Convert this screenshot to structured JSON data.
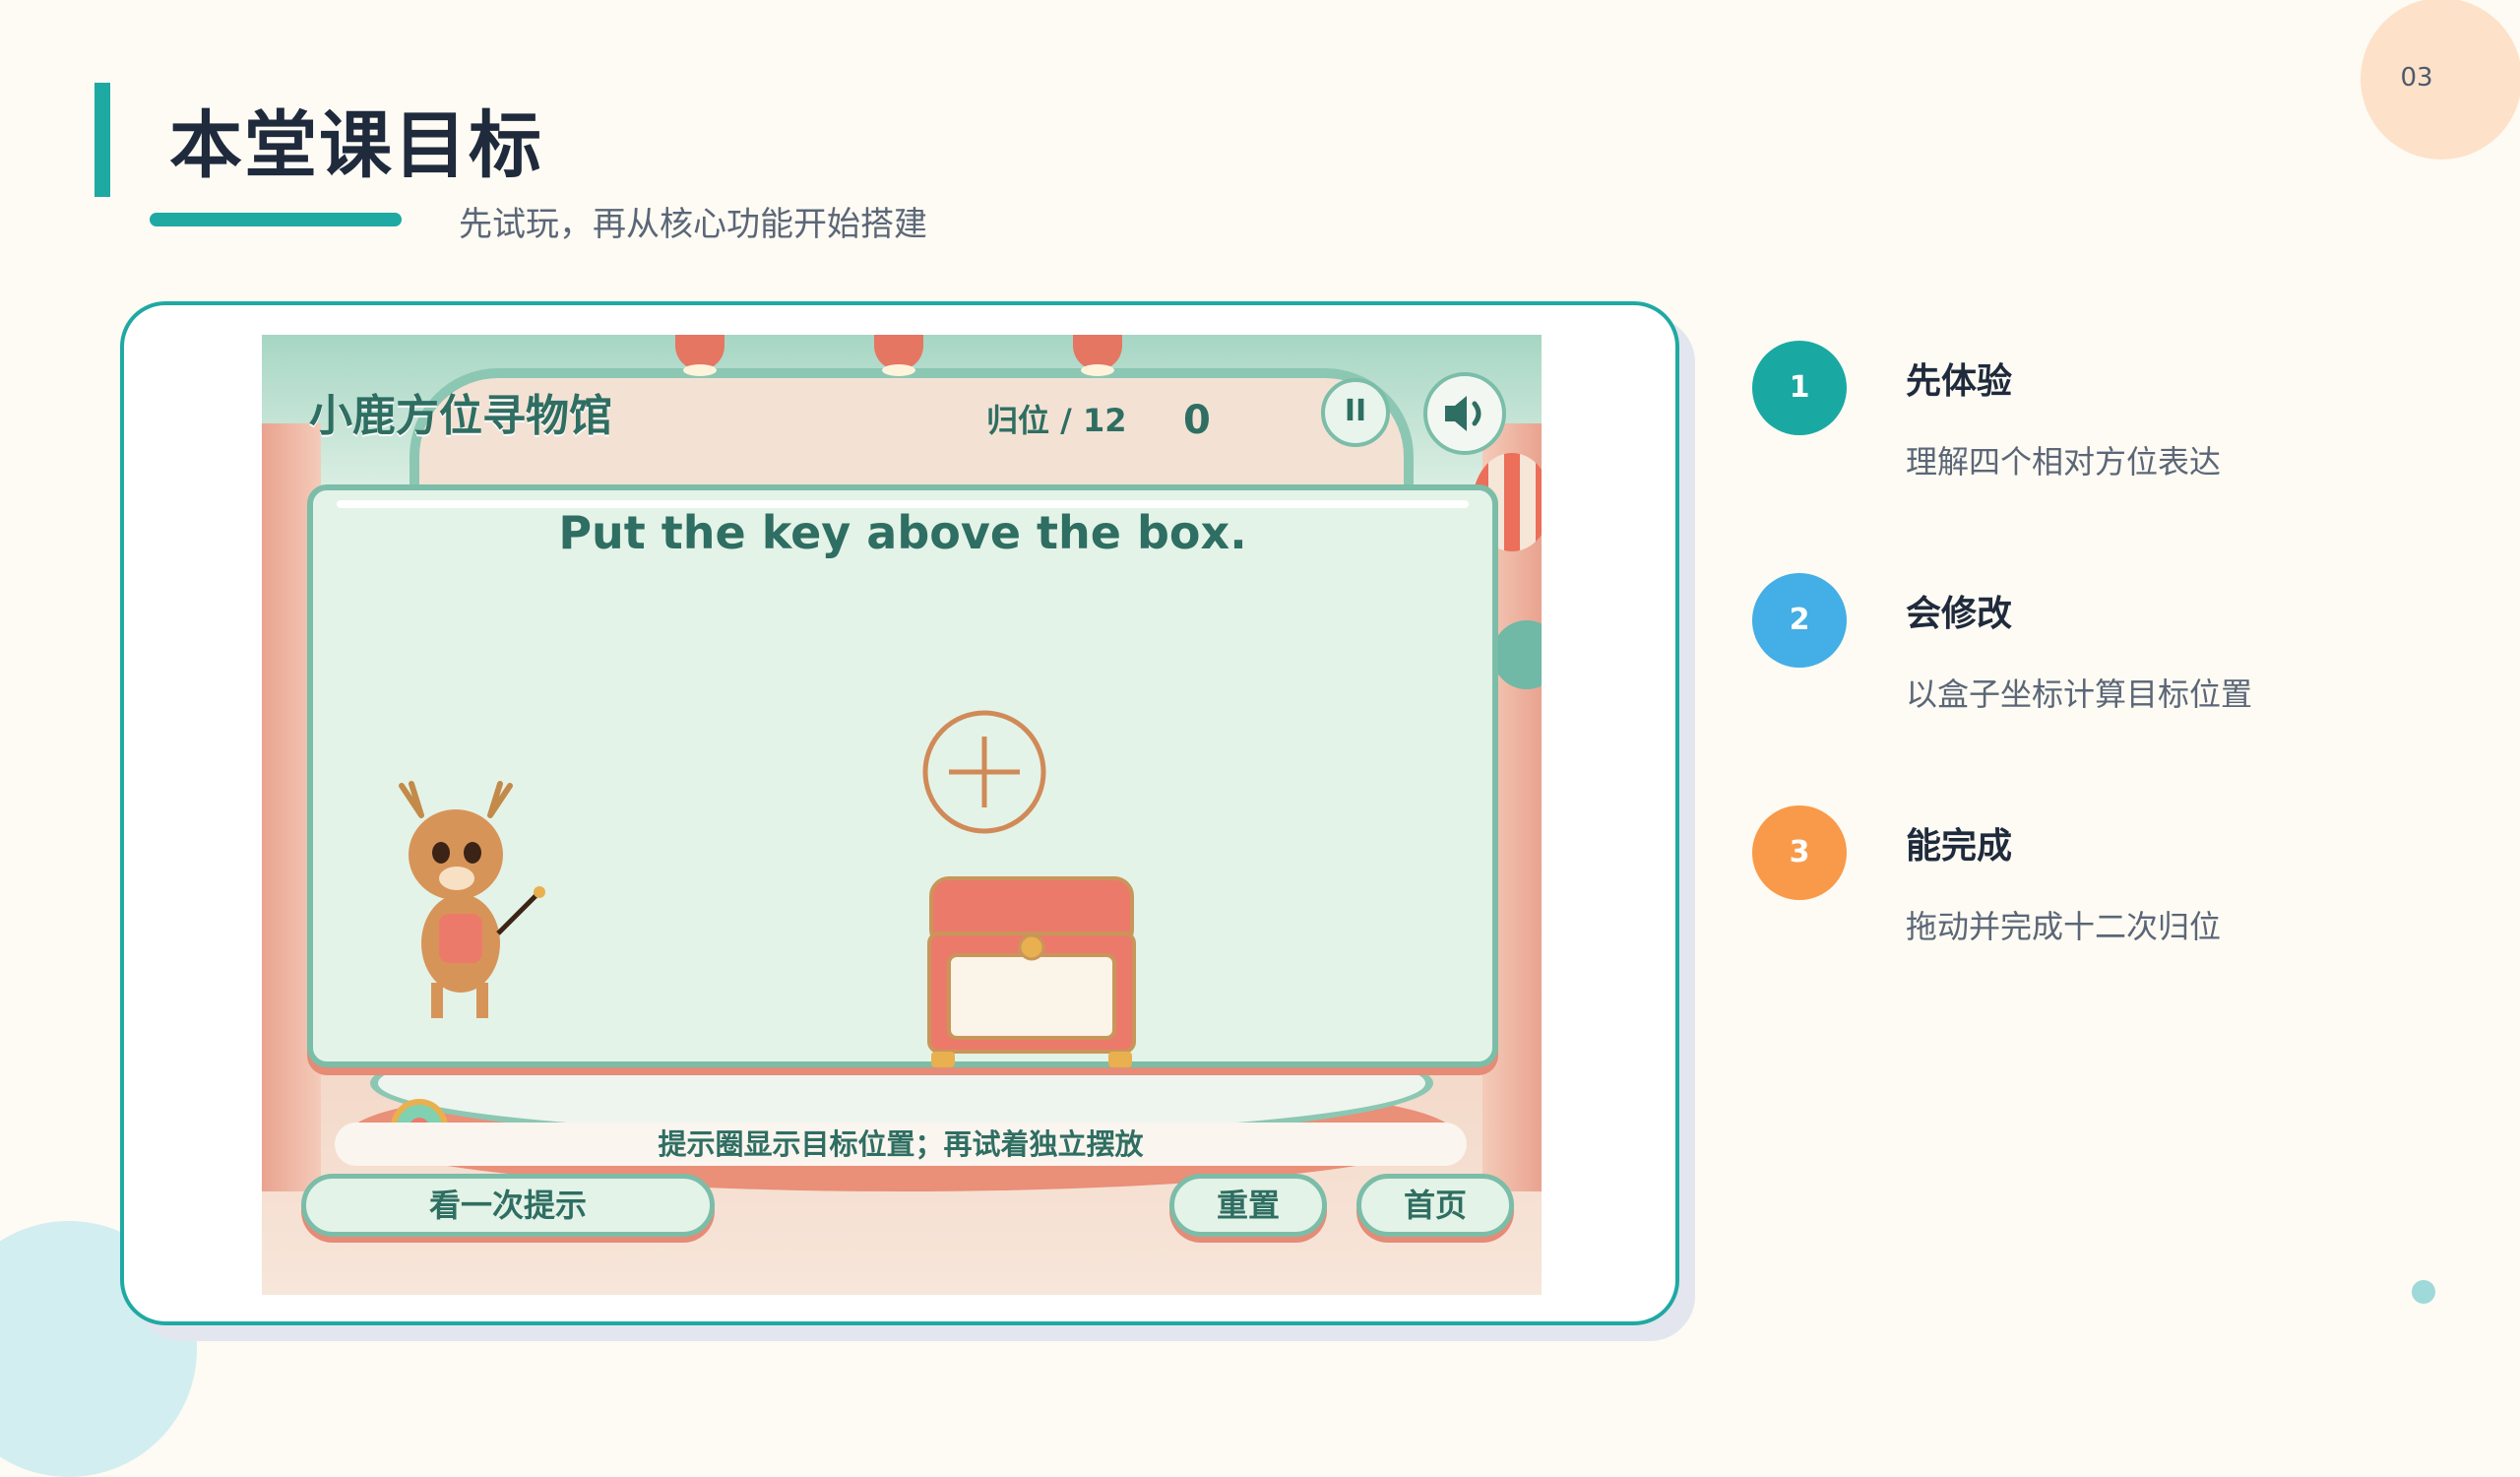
{
  "page_number": "03",
  "header": {
    "title": "本堂课目标",
    "subtitle": "先试玩，再从核心功能开始搭建"
  },
  "game": {
    "title": "小鹿方位寻物馆",
    "progress": "归位 / 12",
    "score": "0",
    "pause_label": "II",
    "instruction": "Put the key above the box.",
    "hint_text": "提示圈显示目标位置；再试着独立摆放",
    "buttons": {
      "hint": "看一次提示",
      "reset": "重置",
      "home": "首页"
    },
    "icons": {
      "sound": "speaker-icon",
      "pause": "pause-icon",
      "target": "crosshair-target-icon",
      "box": "treasure-chest-icon",
      "character": "deer-mascot-icon",
      "key": "golden-key-icon"
    }
  },
  "steps": [
    {
      "number": "1",
      "title": "先体验",
      "desc": "理解四个相对方位表达",
      "color": "#1aa9a2"
    },
    {
      "number": "2",
      "title": "会修改",
      "desc": "以盒子坐标计算目标位置",
      "color": "#44aee6"
    },
    {
      "number": "3",
      "title": "能完成",
      "desc": "拖动并完成十二次归位",
      "color": "#f89a4a"
    }
  ],
  "colors": {
    "accent": "#1fa9a3",
    "background": "#fdfbf3",
    "game_text": "#2f6e62",
    "coral": "#e58b76"
  }
}
